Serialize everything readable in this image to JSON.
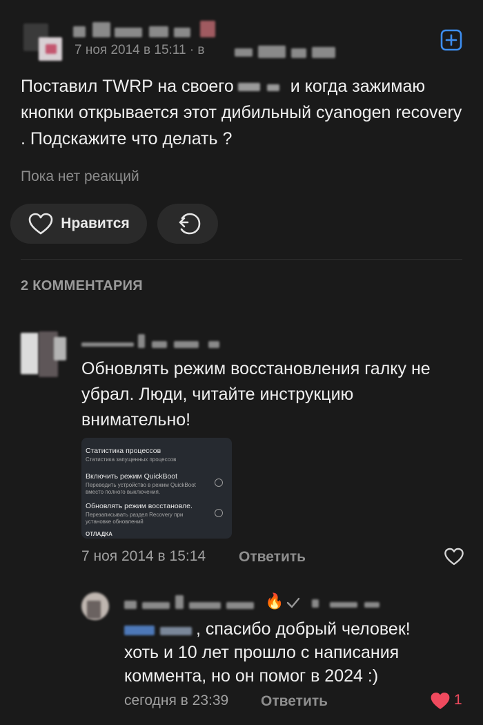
{
  "post": {
    "date": "7 ноя 2014 в 15:11",
    "community_prefix": "· в",
    "text_part1": "Поставил TWRP на своего",
    "text_part2": "и когда зажимаю кнопки открывается этот дибильный cyanogen recovery . Подскажите что делать ?",
    "reactions_empty": "Пока нет реакций",
    "like_label": "Нравится"
  },
  "comments_header": "2 КОММЕНТАРИЯ",
  "comment1": {
    "text": "Обновлять режим восстановления галку не убрал. Люди, читайте инструкцию внимательно!",
    "time": "7 ноя 2014 в 15:14",
    "reply_label": "Ответить",
    "attachment": {
      "row1_title": "Статистика процессов",
      "row1_sub": "Статистика запущенных процессов",
      "row2_title": "Включить режим QuickBoot",
      "row2_sub": "Переводить устройство в режим QuickBoot вместо полного выключения.",
      "row3_title": "Обновлять режим восстановле.",
      "row3_sub": "Перезаписывать раздел Recovery при установке обновлений",
      "section": "ОТЛАДКА"
    }
  },
  "comment2": {
    "text_line1": ", спасибо добрый человек!",
    "text_rest": "хоть и 10 лет прошло с написания коммента, но он помог в 2024 :)",
    "time": "сегодня в 23:39",
    "reply_label": "Ответить",
    "likes": "1",
    "fire_emoji": "🔥"
  },
  "colors": {
    "background": "#1a1a1a",
    "accent": "#3d8ef0",
    "like_active": "#ef4a5e"
  },
  "icons": [
    "add-square-icon",
    "heart-outline-icon",
    "share-icon",
    "heart-filled-icon",
    "verified-check-icon"
  ]
}
